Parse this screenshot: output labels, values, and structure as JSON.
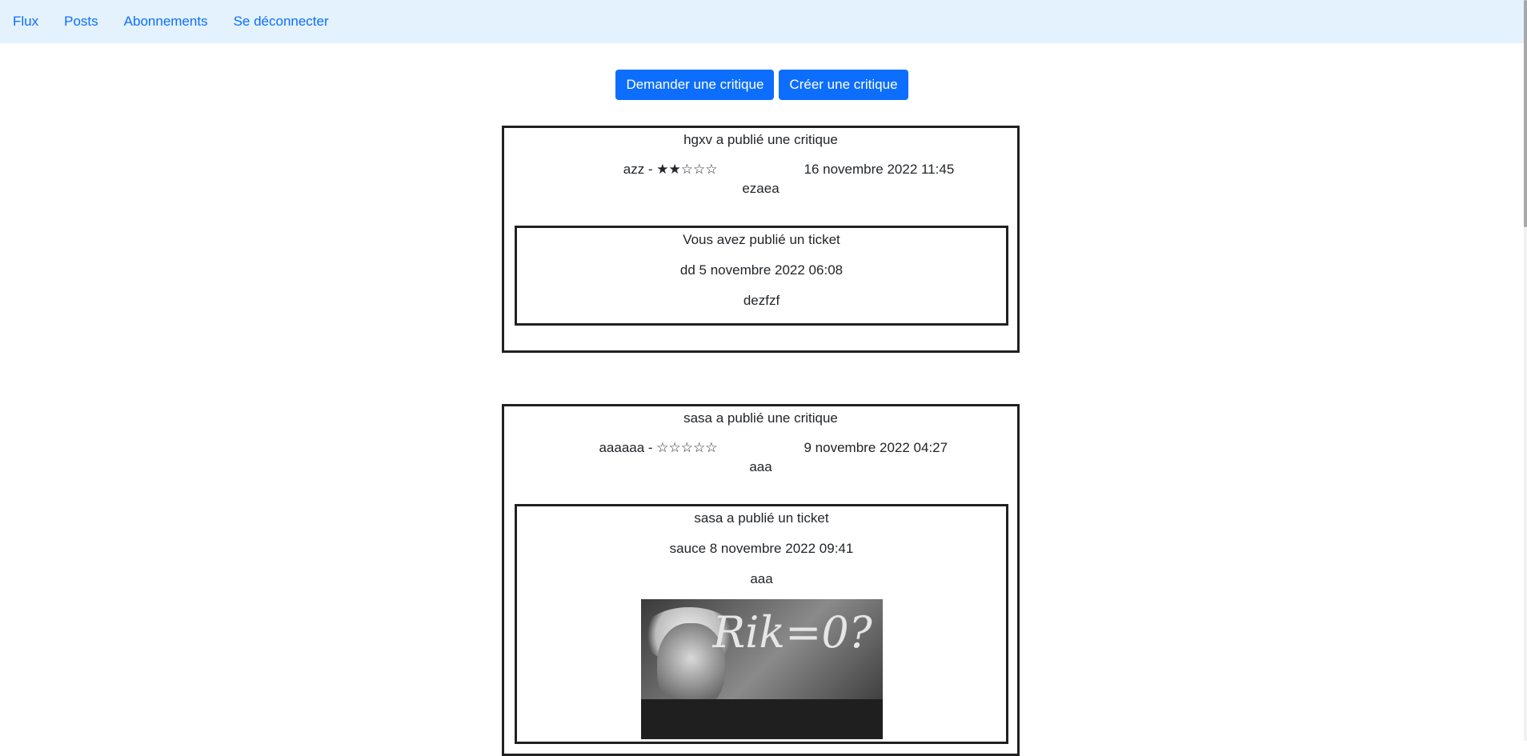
{
  "nav": {
    "items": [
      "Flux",
      "Posts",
      "Abonnements",
      "Se déconnecter"
    ]
  },
  "actions": {
    "request_label": "Demander une critique",
    "create_label": "Créer une critique"
  },
  "posts": [
    {
      "header": "hgxv a publié une critique",
      "rating_line": "azz - ★★☆☆☆",
      "date": "16 novembre 2022 11:45",
      "body": "ezaea",
      "ticket": {
        "header": "Vous avez publié un ticket",
        "title_date": "dd 5 novembre 2022 06:08",
        "description": "dezfzf"
      }
    },
    {
      "header": "sasa a publié une critique",
      "rating_line": "aaaaaa - ☆☆☆☆☆",
      "date": "9 novembre 2022 04:27",
      "body": "aaa",
      "ticket": {
        "header": "sasa a publié un ticket",
        "title_date": "sauce 8 novembre 2022 09:41",
        "description": "aaa",
        "image_text": "Rik=0?"
      }
    }
  ]
}
